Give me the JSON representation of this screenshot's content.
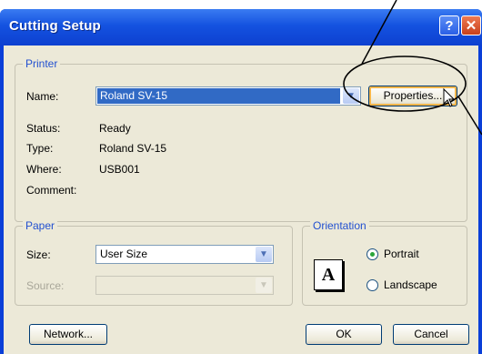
{
  "window": {
    "title": "Cutting Setup",
    "help_glyph": "?",
    "close_glyph": "✕"
  },
  "printer": {
    "legend": "Printer",
    "name_label": "Name:",
    "name_value": "Roland SV-15",
    "properties_label": "Properties...",
    "status_label": "Status:",
    "status_value": "Ready",
    "type_label": "Type:",
    "type_value": "Roland SV-15",
    "where_label": "Where:",
    "where_value": "USB001",
    "comment_label": "Comment:",
    "comment_value": ""
  },
  "paper": {
    "legend": "Paper",
    "size_label": "Size:",
    "size_value": "User Size",
    "source_label": "Source:",
    "source_value": ""
  },
  "orientation": {
    "legend": "Orientation",
    "page_glyph": "A",
    "portrait_label": "Portrait",
    "landscape_label": "Landscape",
    "selected": "Portrait"
  },
  "footer": {
    "network_label": "Network...",
    "ok_label": "OK",
    "cancel_label": "Cancel"
  },
  "colors": {
    "title_blue": "#0a3fd8",
    "legend_blue": "#2250d0",
    "selection_blue": "#316ac5",
    "focus_orange": "#f7b64a"
  }
}
